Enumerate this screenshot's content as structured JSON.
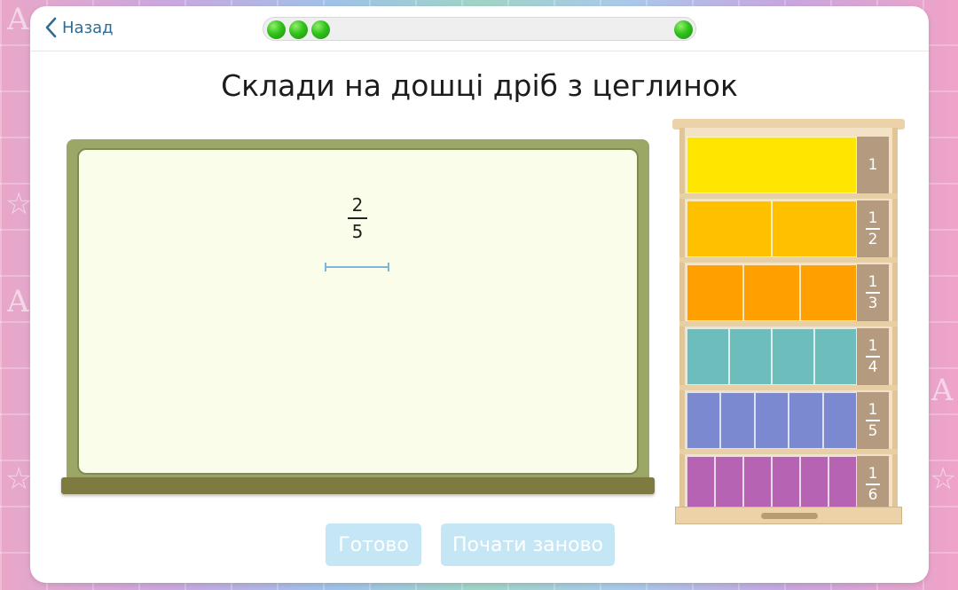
{
  "header": {
    "back_label": "Назад",
    "progress": {
      "completed": 3,
      "total": 4
    }
  },
  "title": "Склади на дошці дріб з цеглинок",
  "target_fraction": {
    "numerator": "2",
    "denominator": "5"
  },
  "buttons": {
    "done": "Готово",
    "restart": "Почати заново"
  },
  "shelf": [
    {
      "count": 1,
      "label": "1",
      "color": "#ffe600"
    },
    {
      "count": 2,
      "numerator": "1",
      "denominator": "2",
      "color": "#ffc000"
    },
    {
      "count": 3,
      "numerator": "1",
      "denominator": "3",
      "color": "#ff9f00"
    },
    {
      "count": 4,
      "numerator": "1",
      "denominator": "4",
      "color": "#6dbdbd"
    },
    {
      "count": 5,
      "numerator": "1",
      "denominator": "5",
      "color": "#7b89d1"
    },
    {
      "count": 6,
      "numerator": "1",
      "denominator": "6",
      "color": "#b763b3"
    }
  ],
  "colors": {
    "accent": "#2f6b93",
    "button_disabled": "#c5e6f4",
    "progress_dot": "#31c21b"
  }
}
